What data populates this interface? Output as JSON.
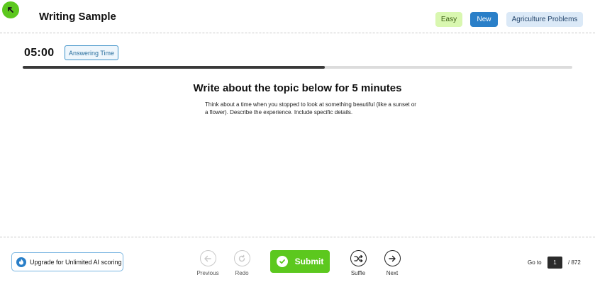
{
  "header": {
    "title": "Writing Sample",
    "tags": {
      "difficulty": "Easy",
      "status": "New",
      "category": "Agriculture Problems"
    }
  },
  "timer": {
    "time": "05:00",
    "mode_label": "Answering Time",
    "progress": 0.55
  },
  "prompt": {
    "heading": "Write about the topic below for 5 minutes",
    "body": "Think about a time when you stopped to look at something beautiful (like a sunset or a flower). Describe the experience. Include specific details."
  },
  "footer": {
    "upgrade_label": "Upgrade for Unlimited AI scoring",
    "previous_label": "Previous",
    "redo_label": "Redo",
    "submit_label": "Submit",
    "shuffle_label": "Suffle",
    "next_label": "Next",
    "goto_label": "Go to",
    "goto_value": "1",
    "goto_total": "/ 872"
  },
  "colors": {
    "accent_green": "#5cc81e",
    "accent_blue": "#2a7fc8"
  },
  "icons": [
    "back-arrow-icon",
    "flame-icon",
    "arrow-left-icon",
    "redo-icon",
    "check-icon",
    "shuffle-icon",
    "arrow-right-icon"
  ]
}
